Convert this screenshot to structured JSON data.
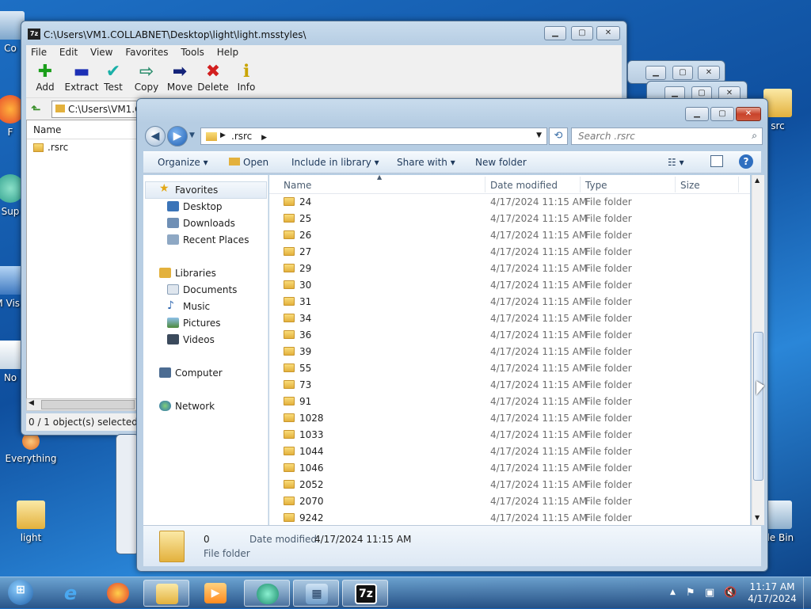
{
  "desktop": {
    "icons": [
      {
        "label": "Co",
        "name": "computer"
      },
      {
        "label": "F",
        "name": "firefox"
      },
      {
        "label": "Sup",
        "name": "support"
      },
      {
        "label": "M Visu",
        "name": "visual-studio"
      },
      {
        "label": "No",
        "name": "notepad"
      },
      {
        "label": "Everything",
        "name": "everything"
      },
      {
        "label": "light",
        "name": "light-folder"
      },
      {
        "label": "src",
        "name": "rsrc-folder"
      },
      {
        "label": "cle Bin",
        "name": "recycle-bin"
      }
    ]
  },
  "zip": {
    "title": "C:\\Users\\VM1.COLLABNET\\Desktop\\light\\light.msstyles\\",
    "app_icon": "7z",
    "menu": [
      "File",
      "Edit",
      "View",
      "Favorites",
      "Tools",
      "Help"
    ],
    "tools": [
      {
        "label": "Add",
        "icon": "plus-icon",
        "glyph": "+",
        "color": "#1a9e1a"
      },
      {
        "label": "Extract",
        "icon": "minus-icon",
        "glyph": "−",
        "color": "#1c2fb5"
      },
      {
        "label": "Test",
        "icon": "check-icon",
        "glyph": "✓",
        "color": "#1ab0a8"
      },
      {
        "label": "Copy",
        "icon": "copy-arrow-icon",
        "glyph": "⇒",
        "color": "#2f8f6f"
      },
      {
        "label": "Move",
        "icon": "move-arrow-icon",
        "glyph": "➡",
        "color": "#14247a"
      },
      {
        "label": "Delete",
        "icon": "delete-x-icon",
        "glyph": "✕",
        "color": "#d21f1f"
      },
      {
        "label": "Info",
        "icon": "info-icon",
        "glyph": "i",
        "color": "#c9a400"
      }
    ],
    "address": "C:\\Users\\VM1.C",
    "column_name": "Name",
    "items": [
      ".rsrc"
    ],
    "status": "0 / 1 object(s) selected"
  },
  "explorer": {
    "breadcrumb": [
      ".rsrc"
    ],
    "search_placeholder": "Search .rsrc",
    "commands": [
      "Organize",
      "Open",
      "Include in library",
      "Share with",
      "New folder"
    ],
    "nav": {
      "favorites_label": "Favorites",
      "favorites": [
        "Desktop",
        "Downloads",
        "Recent Places"
      ],
      "libraries_label": "Libraries",
      "libraries": [
        "Documents",
        "Music",
        "Pictures",
        "Videos"
      ],
      "computer": "Computer",
      "network": "Network"
    },
    "columns": {
      "name": "Name",
      "date": "Date modified",
      "type": "Type",
      "size": "Size"
    },
    "rows": [
      {
        "name": "24",
        "date": "4/17/2024 11:15 AM",
        "type": "File folder"
      },
      {
        "name": "25",
        "date": "4/17/2024 11:15 AM",
        "type": "File folder"
      },
      {
        "name": "26",
        "date": "4/17/2024 11:15 AM",
        "type": "File folder"
      },
      {
        "name": "27",
        "date": "4/17/2024 11:15 AM",
        "type": "File folder"
      },
      {
        "name": "29",
        "date": "4/17/2024 11:15 AM",
        "type": "File folder"
      },
      {
        "name": "30",
        "date": "4/17/2024 11:15 AM",
        "type": "File folder"
      },
      {
        "name": "31",
        "date": "4/17/2024 11:15 AM",
        "type": "File folder"
      },
      {
        "name": "34",
        "date": "4/17/2024 11:15 AM",
        "type": "File folder"
      },
      {
        "name": "36",
        "date": "4/17/2024 11:15 AM",
        "type": "File folder"
      },
      {
        "name": "39",
        "date": "4/17/2024 11:15 AM",
        "type": "File folder"
      },
      {
        "name": "55",
        "date": "4/17/2024 11:15 AM",
        "type": "File folder"
      },
      {
        "name": "73",
        "date": "4/17/2024 11:15 AM",
        "type": "File folder"
      },
      {
        "name": "91",
        "date": "4/17/2024 11:15 AM",
        "type": "File folder"
      },
      {
        "name": "1028",
        "date": "4/17/2024 11:15 AM",
        "type": "File folder"
      },
      {
        "name": "1033",
        "date": "4/17/2024 11:15 AM",
        "type": "File folder"
      },
      {
        "name": "1044",
        "date": "4/17/2024 11:15 AM",
        "type": "File folder"
      },
      {
        "name": "1046",
        "date": "4/17/2024 11:15 AM",
        "type": "File folder"
      },
      {
        "name": "2052",
        "date": "4/17/2024 11:15 AM",
        "type": "File folder"
      },
      {
        "name": "2070",
        "date": "4/17/2024 11:15 AM",
        "type": "File folder"
      },
      {
        "name": "9242",
        "date": "4/17/2024 11:15 AM",
        "type": "File folder"
      }
    ],
    "details": {
      "name": "0",
      "type": "File folder",
      "date_label": "Date modified:",
      "date_value": "4/17/2024 11:15 AM"
    }
  },
  "taskbar": {
    "apps": [
      {
        "name": "start-orb",
        "glyph": "⊞"
      },
      {
        "name": "internet-explorer",
        "glyph": "e"
      },
      {
        "name": "firefox",
        "glyph": "◉"
      },
      {
        "name": "file-explorer",
        "glyph": "▤"
      },
      {
        "name": "media-player",
        "glyph": "▶"
      },
      {
        "name": "app-green",
        "glyph": "◐"
      },
      {
        "name": "control-panel",
        "glyph": "▦"
      },
      {
        "name": "7zip",
        "glyph": "7z"
      }
    ],
    "time": "11:17 AM",
    "date": "4/17/2024"
  },
  "colors": {
    "accent": "#1e395b",
    "folder": "#e3b13d"
  }
}
